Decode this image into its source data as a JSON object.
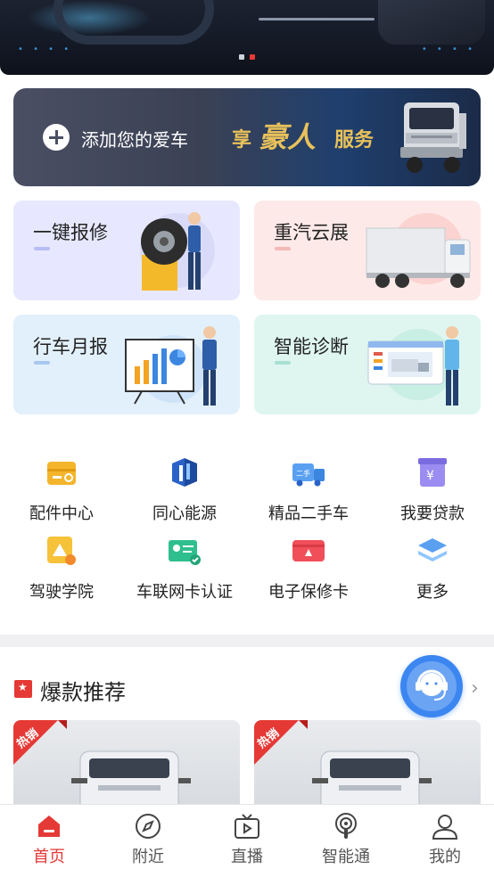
{
  "carousel": {
    "page_count": 2,
    "active_index": 1
  },
  "banner": {
    "add_text": "添加您的爱车",
    "enjoy": "享",
    "brand": "豪人",
    "service": "服务"
  },
  "cards": [
    {
      "title": "一键报修",
      "accent": "#b9bdf5"
    },
    {
      "title": "重汽云展",
      "accent": "#f5b9b6"
    },
    {
      "title": "行车月报",
      "accent": "#a9c8f0"
    },
    {
      "title": "智能诊断",
      "accent": "#a8e0d2"
    }
  ],
  "grid": [
    {
      "label": "配件中心",
      "icon": "parts-box-icon"
    },
    {
      "label": "同心能源",
      "icon": "energy-icon"
    },
    {
      "label": "精品二手车",
      "icon": "used-truck-icon"
    },
    {
      "label": "我要贷款",
      "icon": "loan-icon"
    },
    {
      "label": "驾驶学院",
      "icon": "driving-school-icon"
    },
    {
      "label": "车联网卡认证",
      "icon": "iot-card-icon"
    },
    {
      "label": "电子保修卡",
      "icon": "warranty-card-icon"
    },
    {
      "label": "更多",
      "icon": "layers-icon"
    }
  ],
  "hot": {
    "title": "爆款推荐",
    "badge": "热销"
  },
  "tabs": [
    {
      "label": "首页",
      "icon": "home-icon",
      "active": true
    },
    {
      "label": "附近",
      "icon": "compass-icon",
      "active": false
    },
    {
      "label": "直播",
      "icon": "tv-play-icon",
      "active": false
    },
    {
      "label": "智能通",
      "icon": "podcast-icon",
      "active": false
    },
    {
      "label": "我的",
      "icon": "user-icon",
      "active": false
    }
  ],
  "colors": {
    "accent_red": "#e53935",
    "gold": "#e8c15a",
    "support_blue": "#3b86f0"
  }
}
